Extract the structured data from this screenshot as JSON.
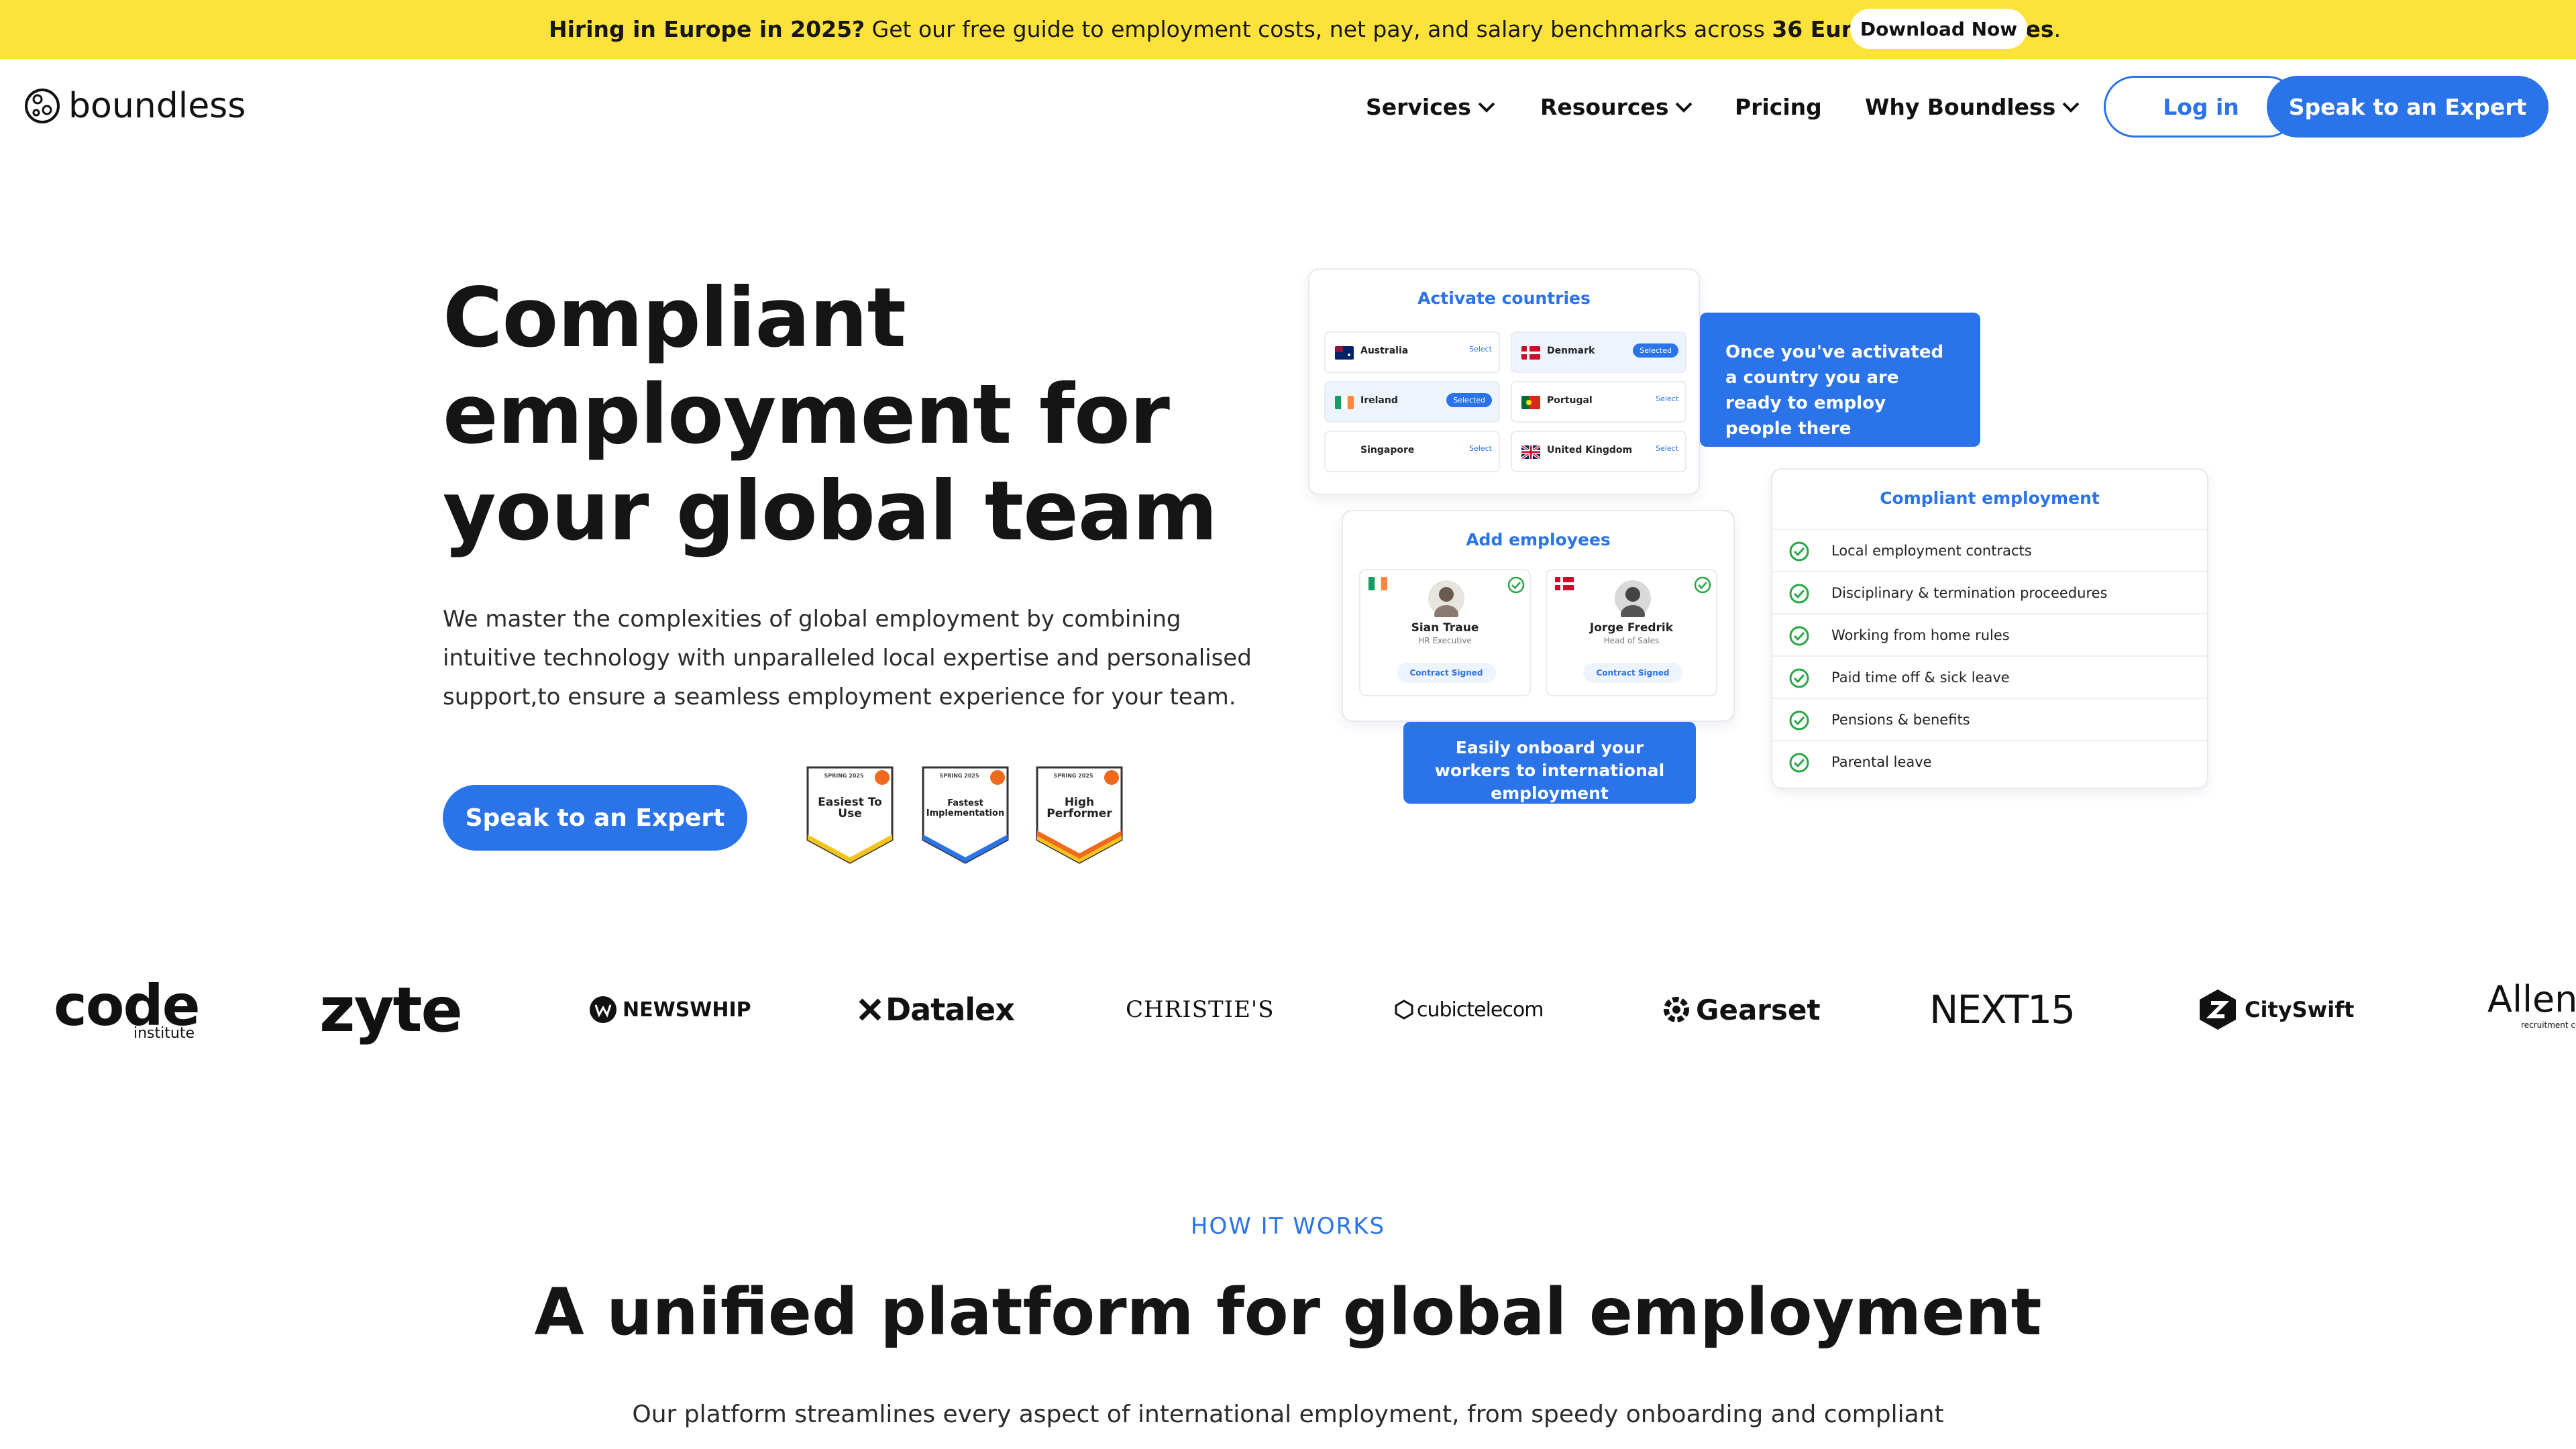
{
  "banner": {
    "bold_lead": "Hiring in Europe in 2025?",
    "text": " Get our free guide to employment costs, net pay, and salary benchmarks across ",
    "bold_count": "36 European countries",
    "end": ".",
    "button": "Download Now",
    "bg_color": "#fde23b"
  },
  "header": {
    "logo_text": "boundless",
    "nav": [
      "Services",
      "Resources",
      "Pricing",
      "Why Boundless"
    ],
    "login": "Log in",
    "cta": "Speak to an Expert",
    "accent_color": "#2a73e8"
  },
  "hero": {
    "title": "Compliant employment for your global team",
    "subtitle": "We master the complexities of global employment by combining intuitive technology with unparalleled local expertise and personalised support,to ensure a seamless employment experience for your team.",
    "cta": "Speak to an Expert",
    "badges": [
      {
        "top": "SPRING 2025",
        "title": "Easiest To Use",
        "color": "#f5c31d"
      },
      {
        "top": "SPRING 2025",
        "title": "Fastest Implementation",
        "color": "#2a73e8"
      },
      {
        "top": "SPRING 2025",
        "title": "High Performer",
        "color": "#f06a1e"
      }
    ]
  },
  "activate": {
    "title": "Activate countries",
    "countries": [
      {
        "name": "Australia",
        "status": "Select"
      },
      {
        "name": "Denmark",
        "status": "Selected"
      },
      {
        "name": "Ireland",
        "status": "Selected"
      },
      {
        "name": "Portugal",
        "status": "Select"
      },
      {
        "name": "Singapore",
        "status": "Select"
      },
      {
        "name": "United Kingdom",
        "status": "Select"
      }
    ],
    "callout": "Once you've activated a country you are ready to employ people there"
  },
  "add_employees": {
    "title": "Add employees",
    "employees": [
      {
        "name": "Sian Traue",
        "role": "HR Executive",
        "status": "Contract Signed"
      },
      {
        "name": "Jorge Fredrik",
        "role": "Head of Sales",
        "status": "Contract Signed"
      }
    ],
    "callout": "Easily onboard your workers to international employment"
  },
  "compliant": {
    "title": "Compliant employment",
    "items": [
      "Local employment contracts",
      "Disciplinary & termination proceedures",
      "Working from home rules",
      "Paid time off & sick leave",
      "Pensions & benefits",
      "Parental leave"
    ]
  },
  "logos": {
    "code": "code",
    "code_sub": "institute",
    "zyte": "zyte",
    "newswhip": "NEWSWHIP",
    "datalex": "Datalex",
    "christies": "CHRISTIE'S",
    "cubic": "cubictelecom",
    "gearset": "Gearset",
    "next15": "NEXT15",
    "cityswift": "CitySwift",
    "allen": "Allen",
    "allen_sub": "recruitment consulting"
  },
  "how": {
    "eyebrow": "HOW IT WORKS",
    "title": "A unified platform for global employment",
    "text": "Our platform streamlines every aspect of international employment, from speedy onboarding and compliant"
  }
}
